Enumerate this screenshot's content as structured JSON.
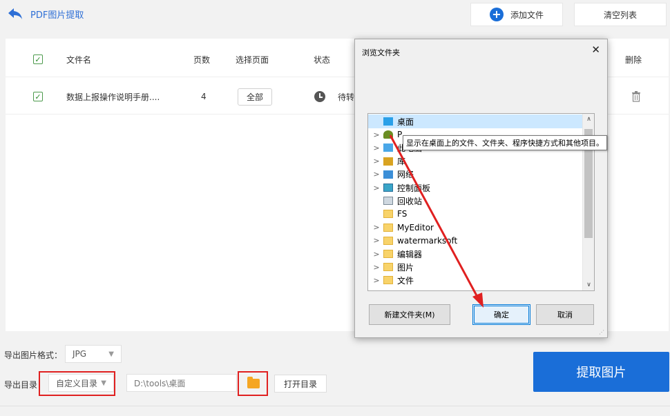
{
  "header": {
    "back_label": "PDF图片提取",
    "add_file_label": "添加文件",
    "clear_list_label": "清空列表"
  },
  "table": {
    "columns": {
      "filename": "文件名",
      "pages": "页数",
      "select_pages": "选择页面",
      "status": "状态",
      "delete": "删除"
    },
    "rows": [
      {
        "checked": true,
        "filename": "数据上报操作说明手册....",
        "pages": "4",
        "select_pages": "全部",
        "status": "待转"
      }
    ]
  },
  "export": {
    "format_label": "导出图片格式：",
    "format_value": "JPG",
    "dir_label": "导出目录：",
    "dir_mode_value": "自定义目录",
    "dir_path": "D:\\tools\\桌面",
    "open_dir_label": "打开目录",
    "extract_label": "提取图片"
  },
  "dialog": {
    "title": "浏览文件夹",
    "close": "✕",
    "tooltip": "显示在桌面上的文件、文件夹、程序快捷方式和其他项目。",
    "tree": [
      {
        "label": "桌面",
        "icon": "desktop-icon",
        "expandable": false,
        "selected": true
      },
      {
        "label": "P",
        "icon": "user-icon",
        "expandable": true
      },
      {
        "label": "此电脑",
        "icon": "computer-icon",
        "expandable": true
      },
      {
        "label": "库",
        "icon": "library-icon",
        "expandable": true
      },
      {
        "label": "网络",
        "icon": "network-icon",
        "expandable": true
      },
      {
        "label": "控制面板",
        "icon": "control-panel-icon",
        "expandable": true
      },
      {
        "label": "回收站",
        "icon": "recycle-bin-icon",
        "expandable": false
      },
      {
        "label": "FS",
        "icon": "folder-icon",
        "expandable": false
      },
      {
        "label": "MyEditor",
        "icon": "folder-icon",
        "expandable": true
      },
      {
        "label": "watermarksoft",
        "icon": "folder-icon",
        "expandable": true
      },
      {
        "label": "编辑器",
        "icon": "folder-icon",
        "expandable": true
      },
      {
        "label": "图片",
        "icon": "folder-icon",
        "expandable": true
      },
      {
        "label": "文件",
        "icon": "folder-icon",
        "expandable": true
      }
    ],
    "new_folder_label": "新建文件夹(M)",
    "ok_label": "确定",
    "cancel_label": "取消"
  },
  "colors": {
    "accent": "#1a6ed8",
    "annotation_red": "#e02020",
    "folder": "#f5a623"
  }
}
